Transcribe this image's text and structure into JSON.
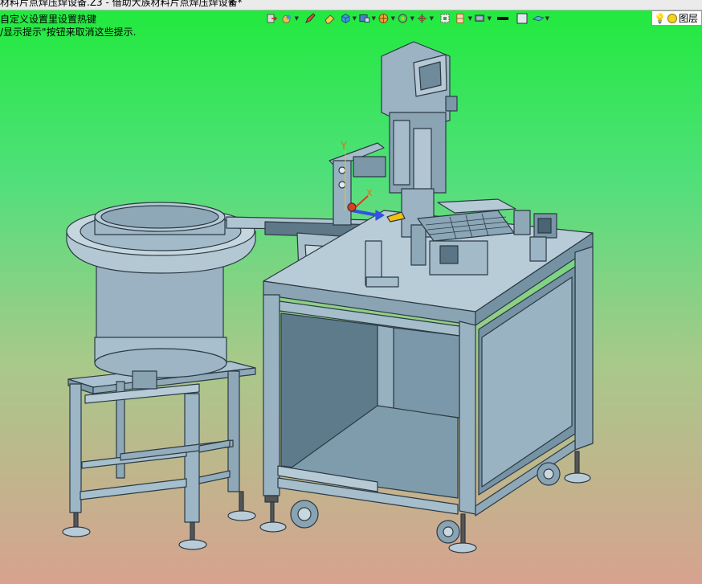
{
  "window": {
    "tab_title": "材料片点焊压焊设备.Z3 - 借助大族材料片点焊压焊设备*",
    "tab_close": "✕"
  },
  "hints": {
    "line1": "自定义设置里设置热键",
    "line2": "/显示提示\"按钮来取消这些提示."
  },
  "toolbar": {
    "icons": [
      "exit-icon",
      "color-icon",
      "pen-icon",
      "eraser-icon",
      "cube-icon",
      "view-icon",
      "shade-icon",
      "snap-icon",
      "target-icon",
      "frame-icon",
      "section-icon",
      "display-icon",
      "line-icon",
      "square-icon",
      "plane-icon"
    ],
    "layer_label": "图层"
  },
  "colors": {
    "background_top": "#1fea3a",
    "background_bottom": "#d7a28f",
    "machine_fill": "#97b4c6",
    "machine_dark": "#5d7a8a",
    "axis_red": "#e23a1e",
    "axis_blue": "#3352e0",
    "axis_yellow": "#f3c010"
  },
  "model": {
    "triad_label_x": "X",
    "triad_label_y": "Y"
  }
}
